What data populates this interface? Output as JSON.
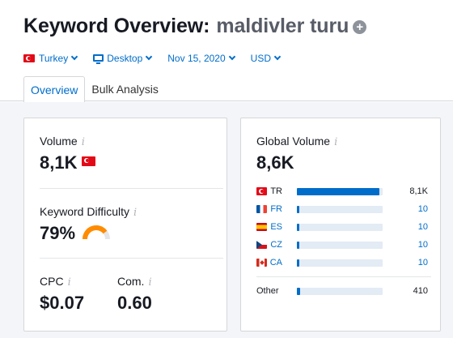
{
  "header": {
    "title": "Keyword Overview:",
    "keyword": "maldivler turu",
    "add_icon": "plus-circle-icon"
  },
  "filters": {
    "country": "Turkey",
    "device": "Desktop",
    "date": "Nov 15, 2020",
    "currency": "USD"
  },
  "tabs": [
    {
      "label": "Overview",
      "active": true
    },
    {
      "label": "Bulk Analysis",
      "active": false
    }
  ],
  "left_card": {
    "volume": {
      "label": "Volume",
      "value": "8,1K",
      "info": "i"
    },
    "difficulty": {
      "label": "Keyword Difficulty",
      "value": "79%",
      "info": "i",
      "level": 0.79,
      "color": "#ff8c00"
    },
    "cpc": {
      "label": "CPC",
      "value": "$0.07",
      "info": "i"
    },
    "com": {
      "label": "Com.",
      "value": "0.60",
      "info": "i"
    }
  },
  "right_card": {
    "label": "Global Volume",
    "info": "i",
    "value": "8,6K",
    "countries": [
      {
        "code": "TR",
        "value": "8,1K",
        "share": 0.96,
        "flag": "turkey-flag-icon"
      },
      {
        "code": "FR",
        "value": "10",
        "share": 0.02,
        "flag": "france-flag-icon"
      },
      {
        "code": "ES",
        "value": "10",
        "share": 0.02,
        "flag": "spain-flag-icon"
      },
      {
        "code": "CZ",
        "value": "10",
        "share": 0.02,
        "flag": "czech-flag-icon"
      },
      {
        "code": "CA",
        "value": "10",
        "share": 0.02,
        "flag": "canada-flag-icon"
      }
    ],
    "other": {
      "label": "Other",
      "value": "410",
      "share": 0.04
    }
  },
  "colors": {
    "accent": "#006dca",
    "bar_track": "#e3ebf5",
    "difficulty": "#ff8c00"
  }
}
